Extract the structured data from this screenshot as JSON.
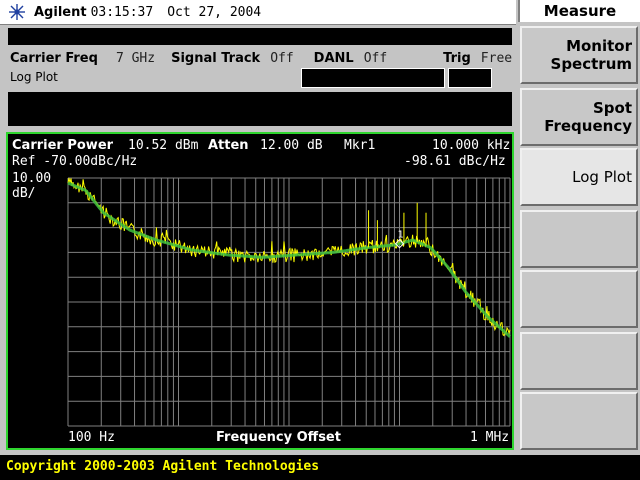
{
  "header": {
    "brand": "Agilent",
    "time": "03:15:37",
    "date": "Oct 27, 2004"
  },
  "softkeys": {
    "menu_title": "Measure",
    "keys": [
      {
        "line1": "Monitor",
        "line2": "Spectrum"
      },
      {
        "line1": "Spot",
        "line2": "Frequency"
      },
      {
        "line1": "Log Plot",
        "line2": ""
      },
      {
        "line1": "",
        "line2": ""
      },
      {
        "line1": "",
        "line2": ""
      },
      {
        "line1": "",
        "line2": ""
      },
      {
        "line1": "",
        "line2": ""
      }
    ]
  },
  "settings": {
    "carrier_freq_label": "Carrier Freq",
    "carrier_freq_value": "7 GHz",
    "signal_track_label": "Signal Track",
    "signal_track_value": "Off",
    "danl_label": "DANL",
    "danl_value": "Off",
    "trig_label": "Trig",
    "trig_value": "Free",
    "view_label": "Log Plot"
  },
  "graph": {
    "carrier_power_label": "Carrier Power",
    "carrier_power_value": "10.52 dBm",
    "atten_label": "Atten",
    "atten_value": "12.00 dB",
    "marker_label": "Mkr1",
    "marker_freq": "10.000 kHz",
    "ref_label": "Ref -70.00dBc/Hz",
    "marker_value": "-98.61 dBc/Hz",
    "scale_value": "10.00",
    "scale_unit": "dB/",
    "start_label": "100 Hz",
    "axis_label": "Frequency Offset",
    "stop_label": "1 MHz",
    "marker_number": "1",
    "trace_color": "#ffff00",
    "smooth_color": "#40c040",
    "border_color": "#2fd62f"
  },
  "status": {
    "copyright": "Copyright 2000-2003 Agilent Technologies"
  }
}
